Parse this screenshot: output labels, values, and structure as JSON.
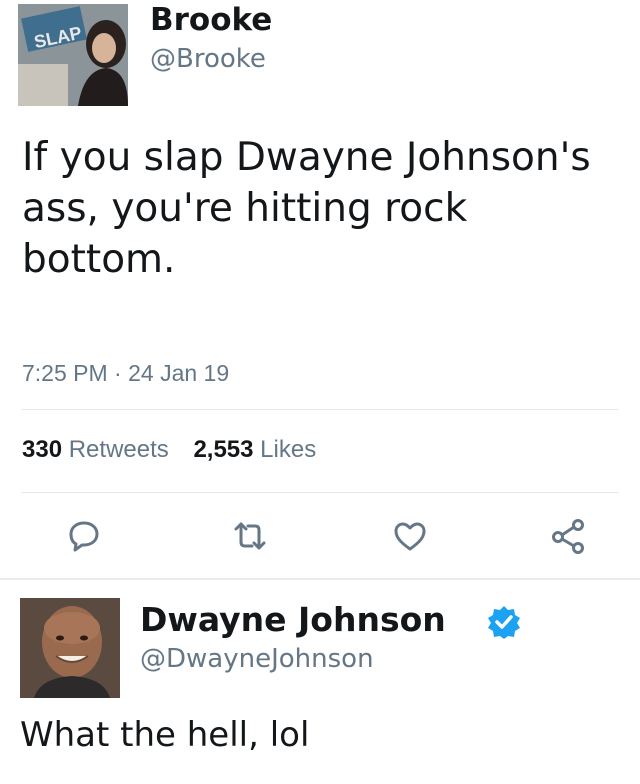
{
  "original_tweet": {
    "display_name": "Brooke",
    "handle": "@Brooke",
    "avatar_text": "SLAP",
    "text": "If you slap Dwayne Johnson's ass, you're hitting rock bottom.",
    "timestamp": "7:25 PM · 24 Jan 19",
    "retweets": {
      "count": "330",
      "label": "Retweets"
    },
    "likes": {
      "count": "2,553",
      "label": "Likes"
    },
    "actions": [
      "reply-icon",
      "retweet-icon",
      "heart-icon",
      "share-icon"
    ]
  },
  "reply_tweet": {
    "display_name": "Dwayne Johnson",
    "handle": "@DwayneJohnson",
    "verified": true,
    "text": "What the hell, lol"
  },
  "colors": {
    "text": "#14171a",
    "secondary_text": "#657786",
    "divider": "#e1e8ed",
    "verified_blue": "#1da1f2",
    "icon_gray": "#657786"
  }
}
